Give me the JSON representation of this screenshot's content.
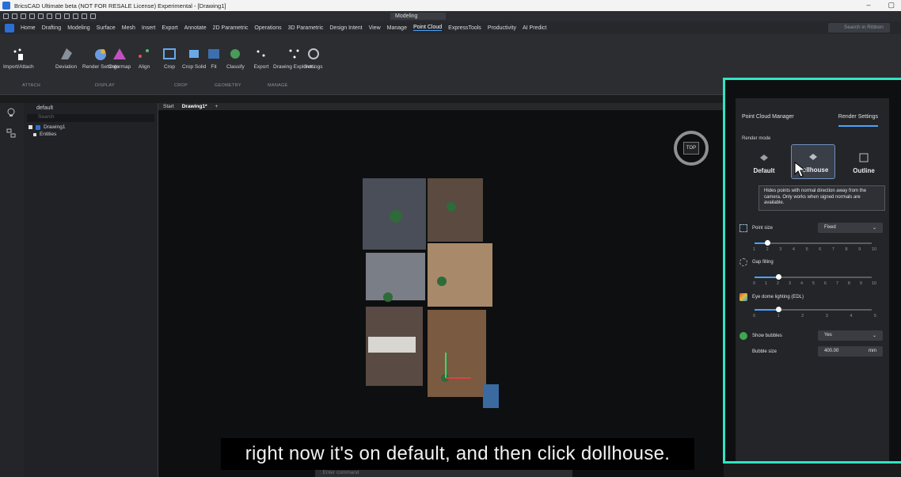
{
  "window": {
    "title": "BricsCAD Ultimate beta (NOT FOR RESALE License) Experimental - [Drawing1]",
    "min": "–",
    "max": "▢"
  },
  "qat": {
    "workspace": "Modeling"
  },
  "ribbon_tabs": [
    "Home",
    "Drafting",
    "Modeling",
    "Surface",
    "Mesh",
    "Insert",
    "Export",
    "Annotate",
    "2D Parametric",
    "Operations",
    "3D Parametric",
    "Design Intent",
    "View",
    "Manage",
    "Point Cloud",
    "ExpressTools",
    "Productivity",
    "AI Predict"
  ],
  "active_tab": "Point Cloud",
  "ribbon_search": "Search in Ribbon",
  "ribbon": {
    "buttons": [
      {
        "label": "Import/Attach"
      },
      {
        "label": "Deviation"
      },
      {
        "label": "Render Settings"
      },
      {
        "label": "Colormap"
      },
      {
        "label": "Align"
      },
      {
        "label": "Crop"
      },
      {
        "label": "Crop Solid"
      },
      {
        "label": "Fit"
      },
      {
        "label": "Classify"
      },
      {
        "label": "Export"
      },
      {
        "label": "Drawing Explorer..."
      },
      {
        "label": "Settings"
      }
    ],
    "groups": [
      "ATTACH",
      "DISPLAY",
      "CROP",
      "GEOMETRY",
      "MANAGE"
    ]
  },
  "left_panel": {
    "header": "default",
    "search_placeholder": "Search",
    "tree": [
      "Drawing1",
      "Entities"
    ]
  },
  "doc_tabs": {
    "start": "Start",
    "drawing": "Drawing1*",
    "plus": "+"
  },
  "viewport": {
    "top_label": "TOP"
  },
  "caption": "right now it's on default, and then click dollhouse.",
  "command_placeholder": ": Enter command",
  "render_panel": {
    "tabs": [
      "Point Cloud Manager",
      "Render Settings"
    ],
    "render_mode_label": "Render mode",
    "modes": [
      "Default",
      "Dollhouse",
      "Outline"
    ],
    "tooltip": "Hides points with normal direction away from the camera. Only works when signed normals are available.",
    "point_size": {
      "label": "Point size",
      "value": "Fixed",
      "ticks": [
        "1",
        "2",
        "3",
        "4",
        "5",
        "6",
        "7",
        "8",
        "9",
        "10"
      ],
      "level": 2
    },
    "gap_filling": {
      "label": "Gap filling",
      "ticks": [
        "0",
        "1",
        "2",
        "3",
        "4",
        "5",
        "6",
        "7",
        "8",
        "9",
        "10"
      ],
      "level": 2
    },
    "edl": {
      "label": "Eye dome lighting (EDL)",
      "ticks": [
        "0",
        "1",
        "2",
        "3",
        "4",
        "5"
      ],
      "level": 1
    },
    "show_bubbles": {
      "label": "Show bubbles",
      "value": "Yes"
    },
    "bubble_size": {
      "label": "Bubble size",
      "value": "400.00",
      "unit": "mm"
    }
  },
  "colors": {
    "accent": "#4aa3ff",
    "highlight_box": "#2ee6c4"
  }
}
